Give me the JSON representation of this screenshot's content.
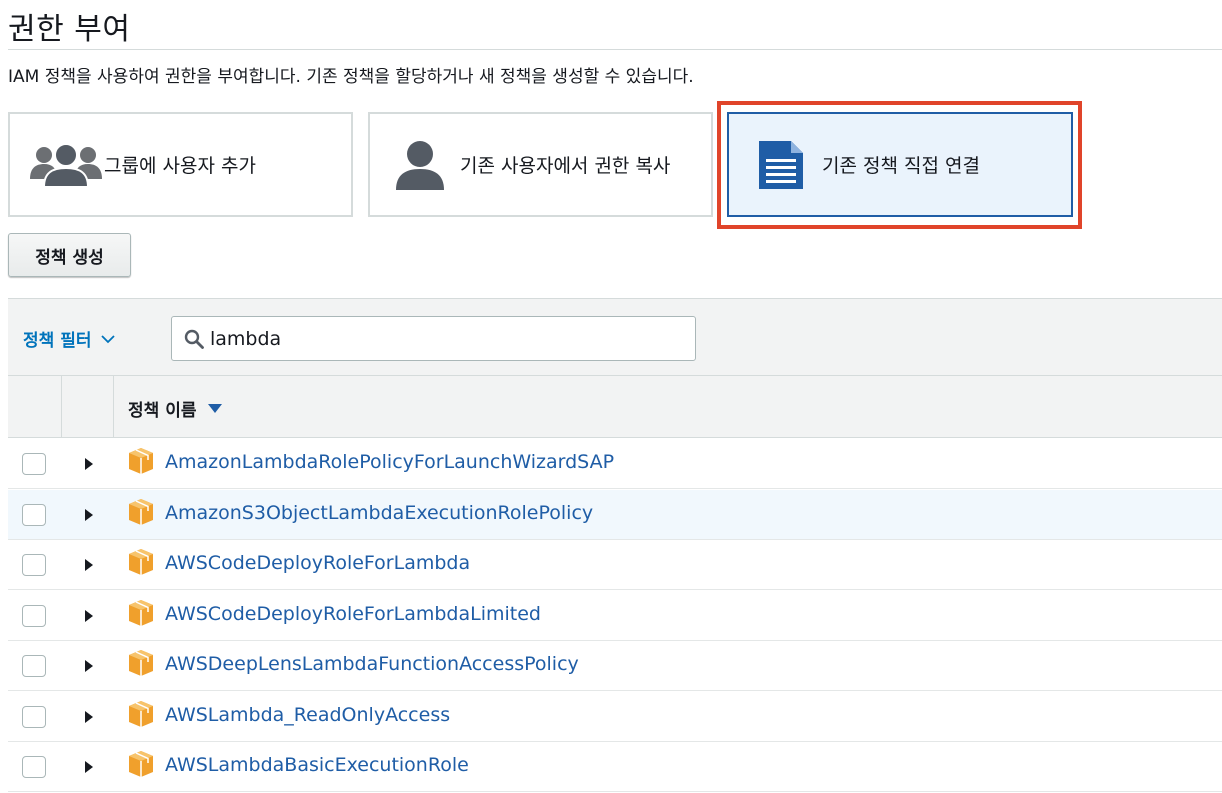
{
  "page": {
    "title": "권한 부여",
    "description": "IAM 정책을 사용하여 권한을 부여합니다. 기존 정책을 할당하거나 새 정책을 생성할 수 있습니다."
  },
  "options": [
    {
      "label": "그룹에 사용자 추가",
      "icon": "user-group-icon",
      "selected": false
    },
    {
      "label": "기존 사용자에서 권한 복사",
      "icon": "user-icon",
      "selected": false
    },
    {
      "label": "기존 정책 직접 연결",
      "icon": "document-icon",
      "selected": true
    }
  ],
  "toolbar": {
    "create_policy_label": "정책 생성"
  },
  "filter": {
    "toggle_label": "정책 필터",
    "search_value": "lambda"
  },
  "table": {
    "column_name_label": "정책 이름",
    "rows": [
      {
        "name": "AmazonLambdaRolePolicyForLaunchWizardSAP"
      },
      {
        "name": "AmazonS3ObjectLambdaExecutionRolePolicy"
      },
      {
        "name": "AWSCodeDeployRoleForLambda"
      },
      {
        "name": "AWSCodeDeployRoleForLambdaLimited"
      },
      {
        "name": "AWSDeepLensLambdaFunctionAccessPolicy"
      },
      {
        "name": "AWSLambda_ReadOnlyAccess"
      },
      {
        "name": "AWSLambdaBasicExecutionRole"
      }
    ]
  },
  "colors": {
    "accent": "#1f5da6",
    "link": "#1f5da6",
    "highlight": "#e0442a",
    "selected_bg": "#eaf3fc",
    "package_icon": "#f0a02c"
  }
}
